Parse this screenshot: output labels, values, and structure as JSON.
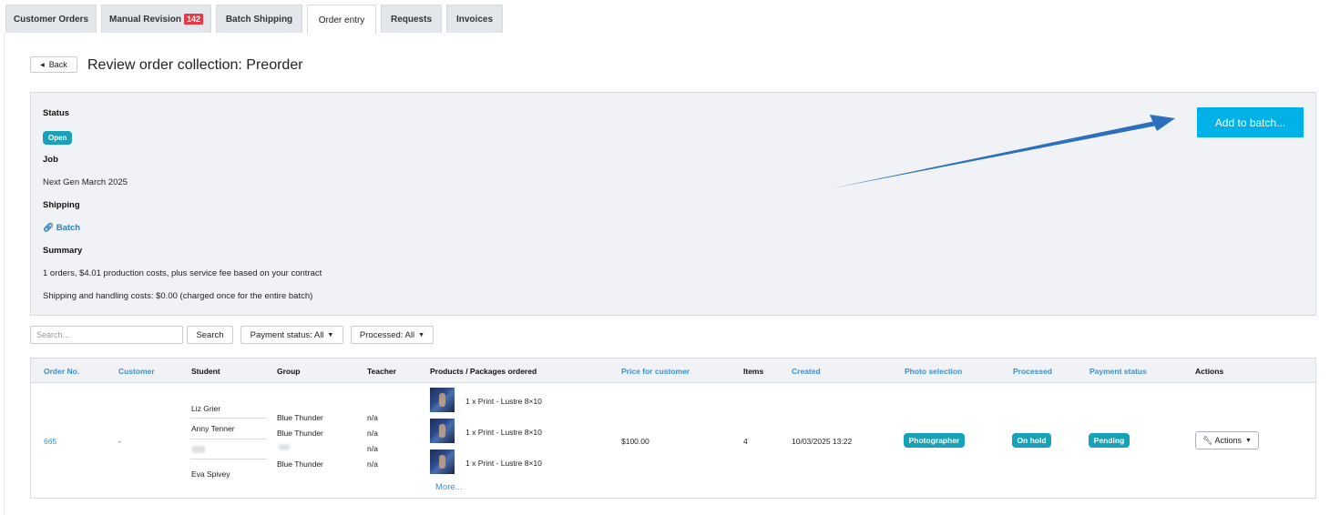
{
  "tabs": [
    {
      "label": "Customer Orders"
    },
    {
      "label": "Manual Revision",
      "badge": "142"
    },
    {
      "label": "Batch Shipping"
    },
    {
      "label": "Order entry",
      "active": true
    },
    {
      "label": "Requests"
    },
    {
      "label": "Invoices"
    }
  ],
  "header": {
    "back_label": "Back",
    "title": "Review order collection: Preorder"
  },
  "info": {
    "status_label": "Status",
    "status_value": "Open",
    "job_label": "Job",
    "job_value": "Next Gen March 2025",
    "shipping_label": "Shipping",
    "shipping_value": "Batch",
    "summary_label": "Summary",
    "summary_line1": "1 orders, $4.01 production costs, plus service fee based on your contract",
    "summary_line2": "Shipping and handling costs: $0.00 (charged once for the entire batch)",
    "add_to_batch_label": "Add to batch..."
  },
  "filters": {
    "search_placeholder": "Search...",
    "search_button": "Search",
    "payment_status_filter": "Payment status: All",
    "processed_filter": "Processed: All"
  },
  "table": {
    "columns": [
      "Order No.",
      "Customer",
      "Student",
      "Group",
      "Teacher",
      "Products / Packages ordered",
      "Price for customer",
      "Items",
      "Created",
      "Photo selection",
      "Processed",
      "Payment status",
      "Actions"
    ],
    "row": {
      "order_no": "665",
      "customer": "-",
      "students": [
        "Liz Grier",
        "Anny Tenner",
        "Eva Spivey"
      ],
      "groups": [
        "Blue Thunder",
        "Blue Thunder",
        "Blue Thunder"
      ],
      "teachers": [
        "n/a",
        "n/a",
        "n/a",
        "n/a"
      ],
      "products": [
        "1 x Print - Lustre 8×10",
        "1 x Print - Lustre 8×10",
        "1 x Print - Lustre 8×10"
      ],
      "more_label": "More...",
      "price": "$100.00",
      "items": "4",
      "created": "10/03/2025 13:22",
      "photo_selection": "Photographer",
      "processed": "On hold",
      "payment_status": "Pending",
      "actions_label": "Actions"
    }
  },
  "colors": {
    "accent": "#00b1e8",
    "pill": "#17a2b8",
    "link": "#3a8fd0",
    "badge": "#e53946",
    "arrow": "#2b6fbd"
  },
  "icons": {
    "back": "triangle-left-icon",
    "batch": "link-icon",
    "actions": "wrench-icon",
    "caret": "caret-down-icon"
  }
}
